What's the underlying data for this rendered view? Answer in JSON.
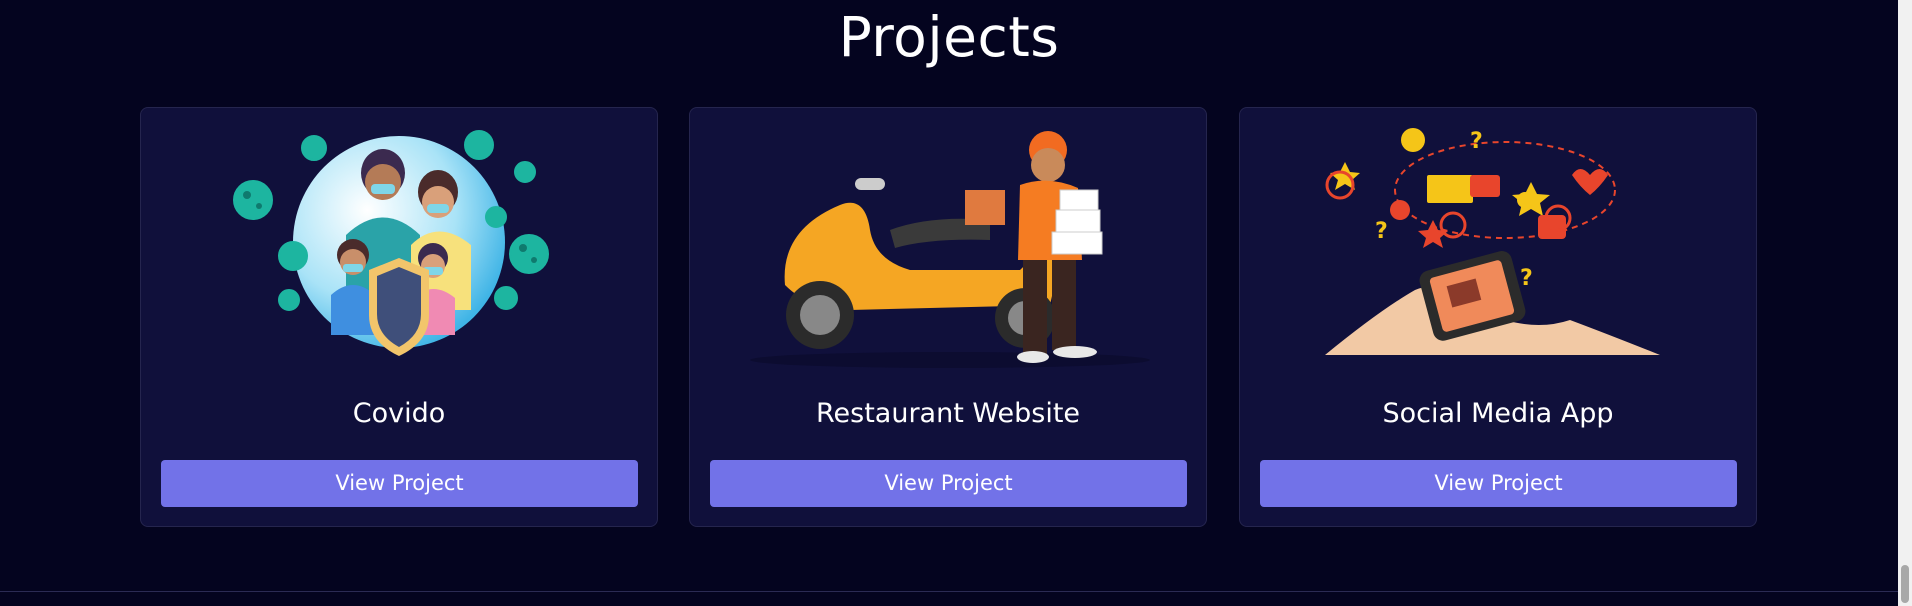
{
  "section": {
    "title": "Projects"
  },
  "projects": [
    {
      "name": "Covido",
      "button_label": "View Project",
      "illustration": "family-virus-shield-illustration"
    },
    {
      "name": "Restaurant Website",
      "button_label": "View Project",
      "illustration": "delivery-scooter-illustration"
    },
    {
      "name": "Social Media App",
      "button_label": "View Project",
      "illustration": "phone-social-icons-illustration"
    }
  ],
  "colors": {
    "background": "#04041f",
    "card": "#10103b",
    "accent": "#7272e8",
    "text": "#ffffff"
  }
}
